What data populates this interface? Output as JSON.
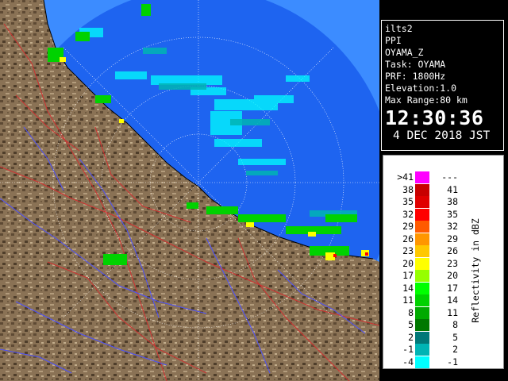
{
  "info": {
    "site": "ilts2",
    "mode": "PPI",
    "product": "OYAMA_Z",
    "task": "Task: OYAMA",
    "prf": "PRF: 1800Hz",
    "elevation": "Elevation:1.0",
    "max_range": "Max Range:80 km",
    "time": "12:30:36",
    "date": "4 DEC 2018 JST"
  },
  "legend": {
    "unit_label": "Reflectivity in dBZ",
    "bins": [
      {
        "lo": ">41",
        "hi": "---",
        "color": "#ff00ff"
      },
      {
        "lo": "38",
        "hi": "41",
        "color": "#c80000"
      },
      {
        "lo": "35",
        "hi": "38",
        "color": "#e00000"
      },
      {
        "lo": "32",
        "hi": "35",
        "color": "#ff0000"
      },
      {
        "lo": "29",
        "hi": "32",
        "color": "#ff5a00"
      },
      {
        "lo": "26",
        "hi": "29",
        "color": "#ff9600"
      },
      {
        "lo": "23",
        "hi": "26",
        "color": "#ffc800"
      },
      {
        "lo": "20",
        "hi": "23",
        "color": "#ffff00"
      },
      {
        "lo": "17",
        "hi": "20",
        "color": "#96ff00"
      },
      {
        "lo": "14",
        "hi": "17",
        "color": "#00ff00"
      },
      {
        "lo": "11",
        "hi": "14",
        "color": "#00d200"
      },
      {
        "lo": "8",
        "hi": "11",
        "color": "#00aa00"
      },
      {
        "lo": "5",
        "hi": "8",
        "color": "#007800"
      },
      {
        "lo": "2",
        "hi": "5",
        "color": "#007878"
      },
      {
        "lo": "-1",
        "hi": "2",
        "color": "#00b4b4"
      },
      {
        "lo": "-4",
        "hi": "-1",
        "color": "#00ffff"
      }
    ]
  },
  "map": {
    "sea_color": "#1e64f0",
    "out_of_range_color": "#3c8cff",
    "land_color": "#8a7255",
    "river_color": "#4b50ff",
    "boundary_color": "#d03030"
  }
}
